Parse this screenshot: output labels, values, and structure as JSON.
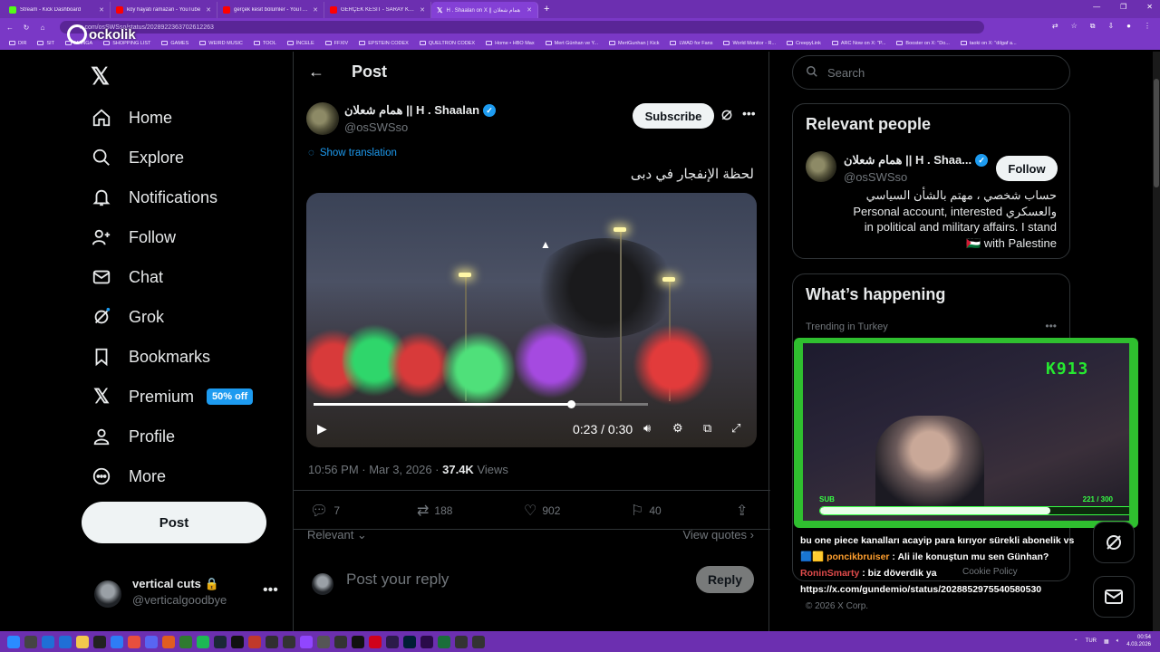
{
  "browser": {
    "tabs": [
      {
        "title": "Stream - Kick Dashboard",
        "color": "#53fc18"
      },
      {
        "title": "köy hayatı ramazan - YouTube",
        "color": "#ff0000"
      },
      {
        "title": "gerçek kesit bölümler - YouTube",
        "color": "#ff0000"
      },
      {
        "title": "GERÇEK KESİT - SARAY KAFETERYA",
        "color": "#ff0000"
      },
      {
        "title": "H . Shaalan on X || همام شعلان",
        "color": "#000000"
      }
    ],
    "url": "x.com/osSWSso/status/2028922363702612263",
    "bookmarks": [
      "DIR",
      "SIT",
      "MANGA",
      "SHOPPING LIST",
      "GAMES",
      "WEIRD MUSIC",
      "TOOL",
      "İNCELE",
      "FFXIV",
      "EPSTEIN CODEX",
      "QUELTRON CODEX",
      "Home • HBO Max",
      "Mert Günhan ve Y...",
      "MertGunhan | Kick",
      "LWAD for Fans",
      "World Monitor - R...",
      "CreepyLink",
      "ARC Now on X: \"P...",
      "Booster on X: \"Do...",
      "taoki on X: \"dilgaf a..."
    ],
    "overlay_logo": "ockolik"
  },
  "nav": {
    "items": [
      {
        "label": "Home",
        "icon": "home-icon"
      },
      {
        "label": "Explore",
        "icon": "search-icon"
      },
      {
        "label": "Notifications",
        "icon": "bell-icon"
      },
      {
        "label": "Follow",
        "icon": "person-add-icon"
      },
      {
        "label": "Chat",
        "icon": "mail-icon"
      },
      {
        "label": "Grok",
        "icon": "grok-icon"
      },
      {
        "label": "Bookmarks",
        "icon": "bookmark-icon"
      },
      {
        "label": "Premium",
        "icon": "x-icon"
      },
      {
        "label": "Profile",
        "icon": "person-icon"
      },
      {
        "label": "More",
        "icon": "more-circle-icon"
      }
    ],
    "premium_badge": "50% off",
    "post_button": "Post",
    "account": {
      "name": "vertical cuts",
      "handle": "@verticalgoodbye"
    }
  },
  "post": {
    "header": "Post",
    "author_name": "همام شعلان || H . Shaalan",
    "author_handle": "@osSWSso",
    "subscribe": "Subscribe",
    "show_translation": "Show translation",
    "text": "لحظة الإنفجار في دبى",
    "video": {
      "time": "0:23 / 0:30",
      "progress": 0.77
    },
    "timestamp": "10:56 PM · Mar 3, 2026 · ",
    "views_count": "37.4K",
    "views_label": " Views",
    "stats": {
      "replies": "7",
      "reposts": "188",
      "likes": "902",
      "bookmarks": "40"
    },
    "sort_label": "Relevant",
    "view_quotes": "View quotes",
    "reply_placeholder": "Post your reply",
    "reply_button": "Reply"
  },
  "sidebar": {
    "search_placeholder": "Search",
    "relevant_title": "Relevant people",
    "person_name": "همام شعلان || H . Shaa...",
    "person_handle": "@osSWSso",
    "follow": "Follow",
    "bio_line1": "حساب شخصي ، مهتم بالشأن السياسي",
    "bio_line2": "Personal account, interested والعسكري",
    "bio_line3": "in political and military affairs. I stand",
    "bio_line4": "🇵🇸 with Palestine",
    "happening_title": "What’s happening",
    "trending_label": "Trending in Turkey",
    "cookie": "Cookie Policy",
    "copyright": "© 2026 X Corp."
  },
  "stream": {
    "code": "K913",
    "sub_label": "SUB",
    "sub_count": "221 / 300",
    "sub_progress": 0.737,
    "chat": [
      {
        "user": "",
        "msg": "bu one piece kanalları acayip para kırıyor sürekli abonelik vs"
      },
      {
        "user": "poncikbruiser",
        "msg": " : Ali ile konuştun mu sen Günhan?"
      },
      {
        "user": "RoninSmarty",
        "msg": " : biz döverdik ya"
      },
      {
        "user": "",
        "msg": "https://x.com/gundemio/status/2028852975540580530"
      }
    ]
  },
  "taskbar": {
    "lang": "TUR",
    "time": "00:54",
    "date": "4.03.2026"
  }
}
